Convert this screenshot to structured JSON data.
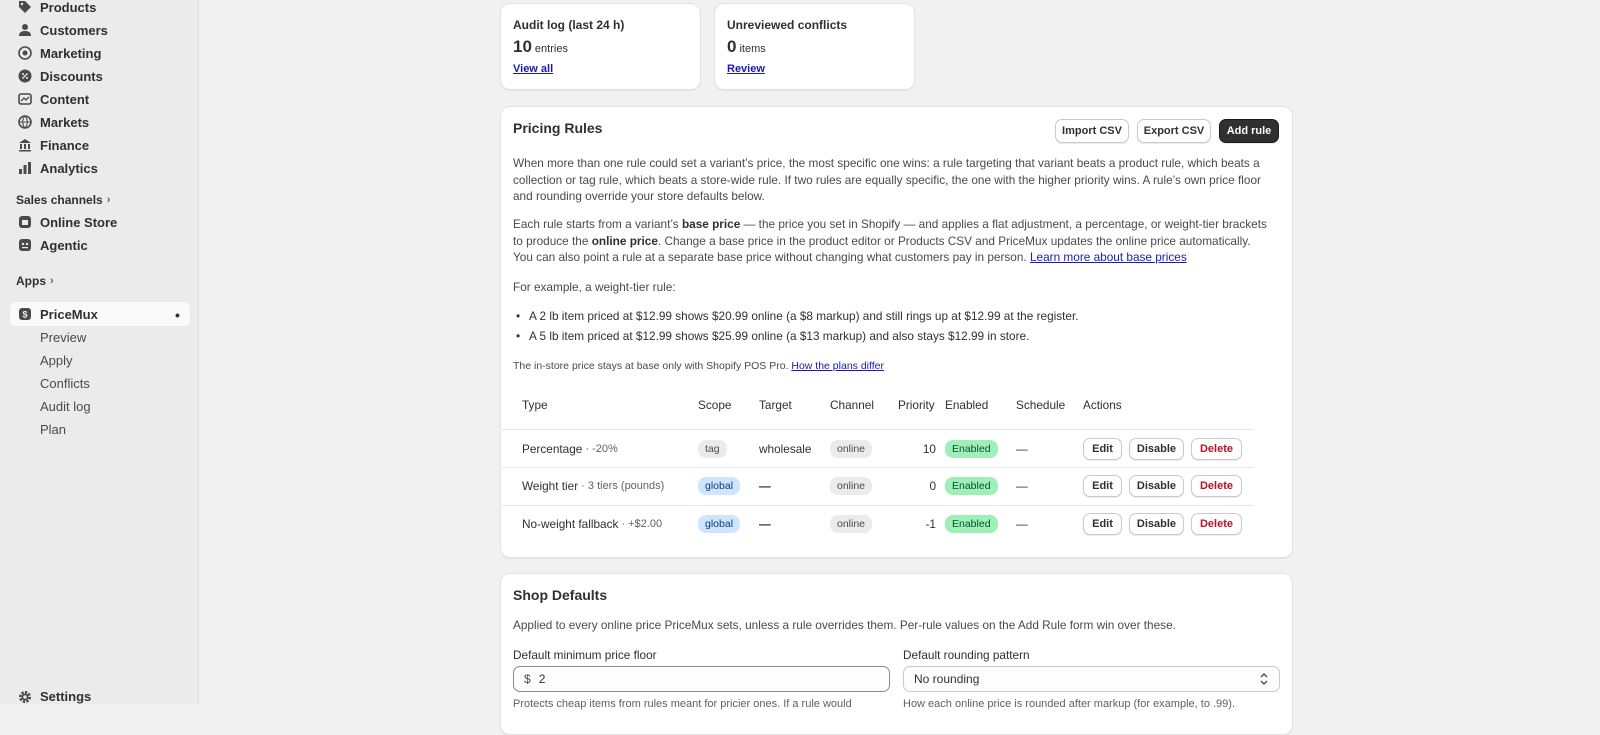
{
  "sidebar": {
    "items": [
      {
        "label": "Products",
        "icon": "tag-icon"
      },
      {
        "label": "Customers",
        "icon": "person-icon"
      },
      {
        "label": "Marketing",
        "icon": "target-icon"
      },
      {
        "label": "Discounts",
        "icon": "discount-icon"
      },
      {
        "label": "Content",
        "icon": "content-icon"
      },
      {
        "label": "Markets",
        "icon": "globe-icon"
      },
      {
        "label": "Finance",
        "icon": "bank-icon"
      },
      {
        "label": "Analytics",
        "icon": "chart-icon"
      }
    ],
    "sales_channels_label": "Sales channels",
    "channels": [
      {
        "label": "Online Store",
        "icon": "store-icon"
      },
      {
        "label": "Agentic",
        "icon": "agentic-icon"
      }
    ],
    "apps_label": "Apps",
    "app": {
      "label": "PriceMux",
      "menu_glyph": "•",
      "subitems": [
        "Preview",
        "Apply",
        "Conflicts",
        "Audit log",
        "Plan"
      ]
    },
    "settings_label": "Settings"
  },
  "stats": [
    {
      "title": "Audit log (last 24 h)",
      "value": "10",
      "unit": "entries",
      "link": "View all"
    },
    {
      "title": "Unreviewed conflicts",
      "value": "0",
      "unit": "items",
      "link": "Review"
    }
  ],
  "pricing_rules": {
    "title": "Pricing Rules",
    "buttons": {
      "import": "Import CSV",
      "export": "Export CSV",
      "add": "Add rule"
    },
    "para1": "When more than one rule could set a variant’s price, the most specific one wins: a rule targeting that variant beats a product rule, which beats a collection or tag rule, which beats a store-wide rule. If two rules are equally specific, the one with the higher priority wins. A rule’s own price floor and rounding override your store defaults below.",
    "para2": {
      "t1": "Each rule starts from a variant’s ",
      "b1": "base price",
      "t2": " — the price you set in Shopify — and applies a flat adjustment, a percentage, or weight-tier brackets to produce the ",
      "b2": "online price",
      "t3": ". Change a base price in the product editor or Products CSV and PriceMux updates the online price automatically. You can also point a rule at a separate base price without changing what customers pay in person. ",
      "link": "Learn more about base prices"
    },
    "example_intro": "For example, a weight-tier rule:",
    "bullets": [
      "A 2 lb item priced at $12.99 shows $20.99 online (a $8 markup) and still rings up at $12.99 at the register.",
      "A 5 lb item priced at $12.99 shows $25.99 online (a $13 markup) and also stays $12.99 in store."
    ],
    "note": "The in-store price stays at base only with Shopify POS Pro. ",
    "note_link": "How the plans differ",
    "table": {
      "headers": [
        "Type",
        "Scope",
        "Target",
        "Channel",
        "Priority",
        "Enabled",
        "Schedule",
        "Actions"
      ],
      "rows": [
        {
          "type": "Percentage",
          "meta": "· -20%",
          "scope": "tag",
          "scope_style": "tag",
          "target": "wholesale",
          "channel": "online",
          "priority": "10",
          "enabled": "Enabled",
          "schedule": "—"
        },
        {
          "type": "Weight tier",
          "meta": "· 3 tiers (pounds)",
          "scope": "global",
          "scope_style": "global",
          "target": "—",
          "channel": "online",
          "priority": "0",
          "enabled": "Enabled",
          "schedule": "—"
        },
        {
          "type": "No-weight fallback",
          "meta": "· +$2.00",
          "scope": "global",
          "scope_style": "global",
          "target": "—",
          "channel": "online",
          "priority": "-1",
          "enabled": "Enabled",
          "schedule": "—"
        }
      ],
      "actions": {
        "edit": "Edit",
        "disable": "Disable",
        "delete": "Delete"
      }
    }
  },
  "shop_defaults": {
    "title": "Shop Defaults",
    "description": "Applied to every online price PriceMux sets, unless a rule overrides them. Per-rule values on the Add Rule form win over these.",
    "floor_label": "Default minimum price floor",
    "currency_prefix": "$",
    "floor_value": "2",
    "floor_help": "Protects cheap items from rules meant for pricier ones. If a rule would",
    "rounding_label": "Default rounding pattern",
    "rounding_value": "No rounding",
    "rounding_help": "How each online price is rounded after markup (for example, to .99)."
  },
  "colors": {
    "accent_link": "#1a1ab0",
    "primary_button": "#303030",
    "enabled_badge": "#9ef0b8",
    "global_badge": "#cfe5ff",
    "delete_text": "#b4122a"
  }
}
